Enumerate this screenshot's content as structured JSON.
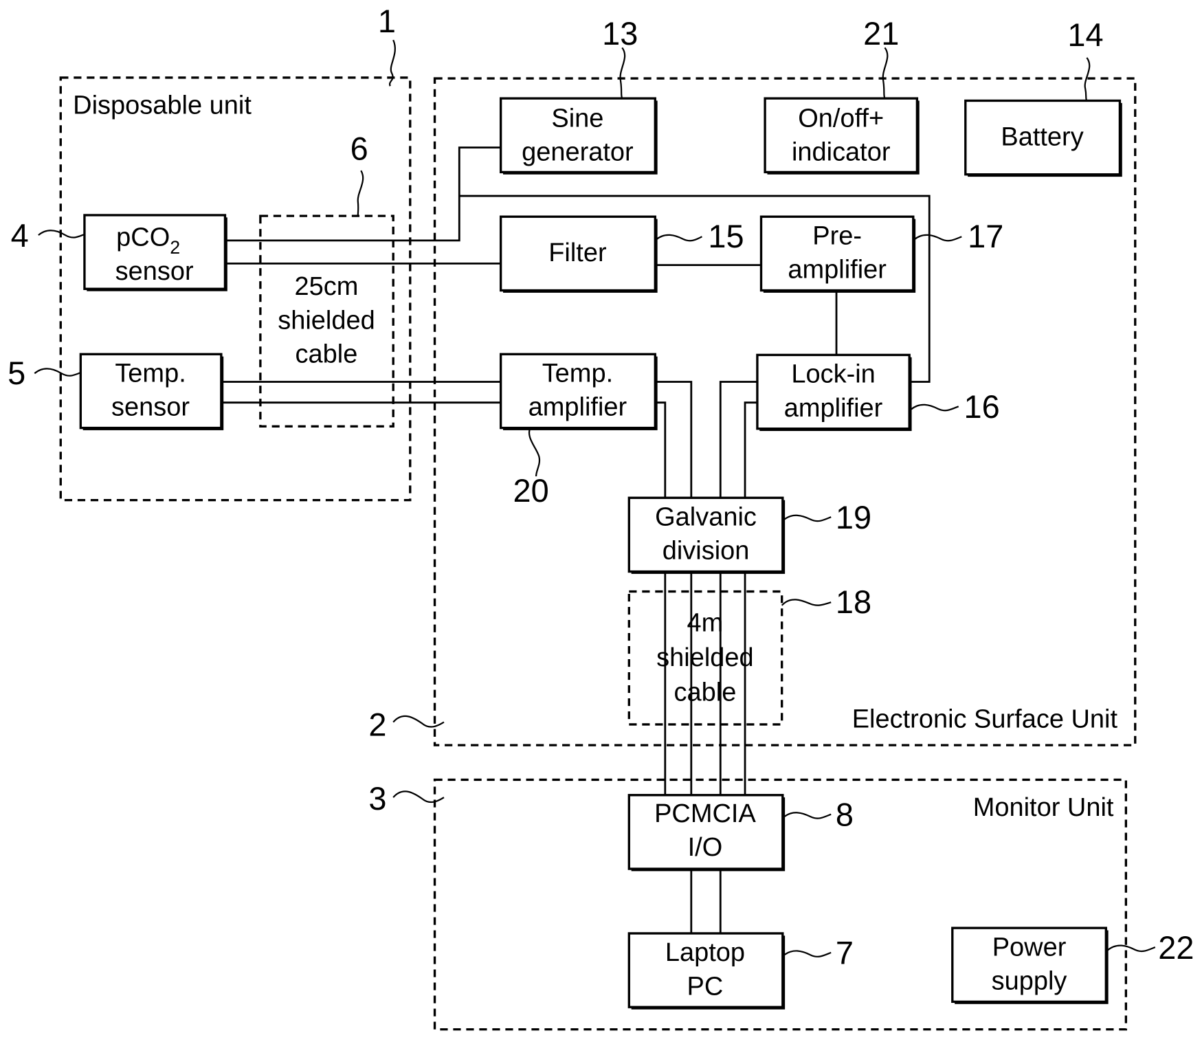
{
  "figure": {
    "units": [
      {
        "id": "disposable",
        "ref": "1",
        "title": "Disposable unit"
      },
      {
        "id": "surface",
        "ref": "2",
        "title": "Electronic Surface Unit"
      },
      {
        "id": "monitor",
        "ref": "3",
        "title": "Monitor Unit"
      }
    ],
    "blocks": {
      "pco2": {
        "ref": "4",
        "line1": "pCO",
        "line1_sub": "2",
        "line2": "sensor"
      },
      "temp_sensor": {
        "ref": "5",
        "line1": "Temp.",
        "line2": "sensor"
      },
      "cable25": {
        "ref": "6",
        "line1": "25cm",
        "line2": "shielded",
        "line3": "cable"
      },
      "sine": {
        "ref": "13",
        "line1": "Sine",
        "line2": "generator"
      },
      "onoff": {
        "ref": "21",
        "line1": "On/off+",
        "line2": "indicator"
      },
      "battery": {
        "ref": "14",
        "line1": "Battery"
      },
      "filter": {
        "ref": "15",
        "line1": "Filter"
      },
      "preamp": {
        "ref": "17",
        "line1": "Pre-",
        "line2": "amplifier"
      },
      "temp_amp": {
        "ref": "20",
        "line1": "Temp.",
        "line2": "amplifier"
      },
      "lockin": {
        "ref": "16",
        "line1": "Lock-in",
        "line2": "amplifier"
      },
      "galvanic": {
        "ref": "19",
        "line1": "Galvanic",
        "line2": "division"
      },
      "cable4m": {
        "ref": "18",
        "line1": "4m",
        "line2": "shielded",
        "line3": "cable"
      },
      "pcmcia": {
        "ref": "8",
        "line1": "PCMCIA",
        "line2": "I/O"
      },
      "laptop": {
        "ref": "7",
        "line1": "Laptop",
        "line2": "PC"
      },
      "power": {
        "ref": "22",
        "line1": "Power",
        "line2": "supply"
      }
    }
  }
}
